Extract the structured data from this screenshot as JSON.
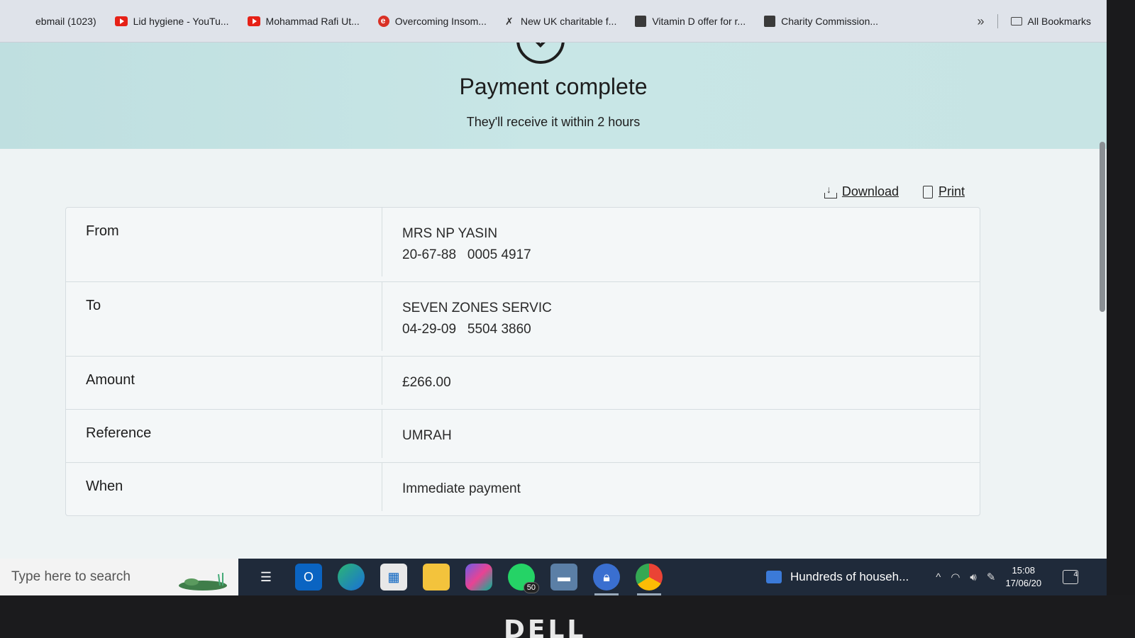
{
  "bookmarks": {
    "items": [
      {
        "label": "ebmail (1023)",
        "icon": "mail-icon"
      },
      {
        "label": "Lid hygiene - YouTu...",
        "icon": "youtube-icon"
      },
      {
        "label": "Mohammad Rafi Ut...",
        "icon": "youtube-icon"
      },
      {
        "label": "Overcoming Insom...",
        "icon": "edge-e-icon"
      },
      {
        "label": "New UK charitable f...",
        "icon": "pin-icon"
      },
      {
        "label": "Vitamin D offer for r...",
        "icon": "site-icon"
      },
      {
        "label": "Charity Commission...",
        "icon": "site-icon"
      }
    ],
    "all_bookmarks": "All Bookmarks",
    "more": "»"
  },
  "banner": {
    "title": "Payment complete",
    "subtitle": "They'll receive it within 2 hours"
  },
  "actions": {
    "download": "Download",
    "print": "Print"
  },
  "details": {
    "from": {
      "label": "From",
      "name": "MRS NP YASIN",
      "account": "20-67-88   0005 4917"
    },
    "to": {
      "label": "To",
      "name": "SEVEN ZONES SERVIC",
      "account": "04-29-09   5504 3860"
    },
    "amount": {
      "label": "Amount",
      "value": "£266.00"
    },
    "reference": {
      "label": "Reference",
      "value": "UMRAH"
    },
    "when": {
      "label": "When",
      "value": "Immediate payment"
    }
  },
  "taskbar": {
    "search_placeholder": "Type here to search",
    "whatsapp_badge": "50",
    "news": "Hundreds of househ...",
    "time": "15:08",
    "date": "17/06/20",
    "notifications": "4"
  },
  "device": {
    "brand": "DELL"
  },
  "colors": {
    "banner": "#c4e3e3",
    "page_bg": "#eef3f4",
    "taskbar": "#1f2a3a"
  }
}
